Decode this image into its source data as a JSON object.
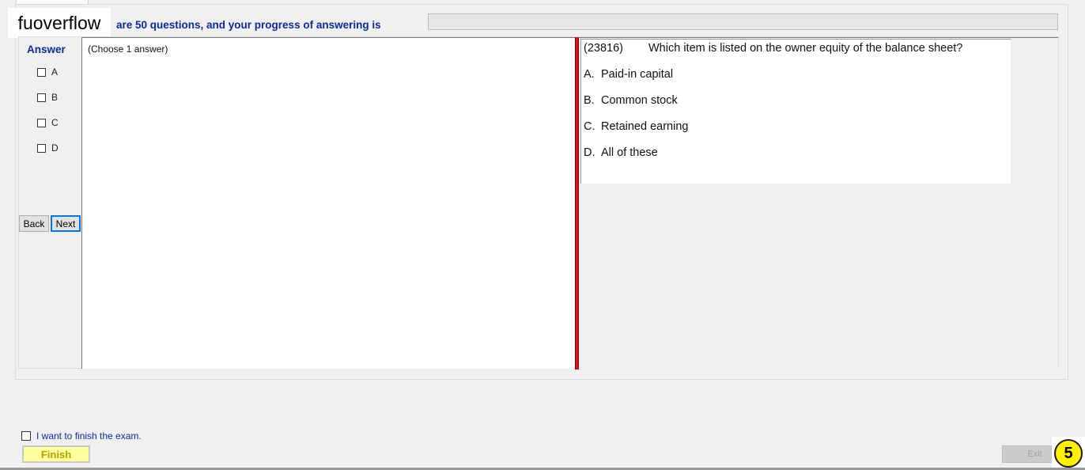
{
  "logo": {
    "text": "fuoverflow"
  },
  "progress": {
    "text": "are 50 questions, and your progress of answering is",
    "fraction": 0.0
  },
  "answer_panel": {
    "title": "Answer",
    "options": [
      {
        "label": "A",
        "checked": false
      },
      {
        "label": "B",
        "checked": false
      },
      {
        "label": "C",
        "checked": false
      },
      {
        "label": "D",
        "checked": false
      }
    ],
    "back_label": "Back",
    "next_label": "Next"
  },
  "answer_box": {
    "hint": "(Choose 1 answer)"
  },
  "question": {
    "id": "(23816)",
    "text": "Which item is listed on the owner equity of the balance sheet?",
    "options": [
      {
        "letter": "A.",
        "text": "Paid-in capital"
      },
      {
        "letter": "B.",
        "text": "Common stock"
      },
      {
        "letter": "C.",
        "text": "Retained earning"
      },
      {
        "letter": "D.",
        "text": "All of these"
      }
    ]
  },
  "footer": {
    "finish_check_label": "I want to finish the exam.",
    "finish_checked": false,
    "finish_label": "Finish",
    "exit_label": "Exit",
    "badge": "5"
  },
  "colors": {
    "label_blue": "#0c2a9a",
    "splitter_red": "#cc1a1a",
    "finish_yellow": "#ffffa0",
    "badge_yellow": "#ffef00"
  }
}
